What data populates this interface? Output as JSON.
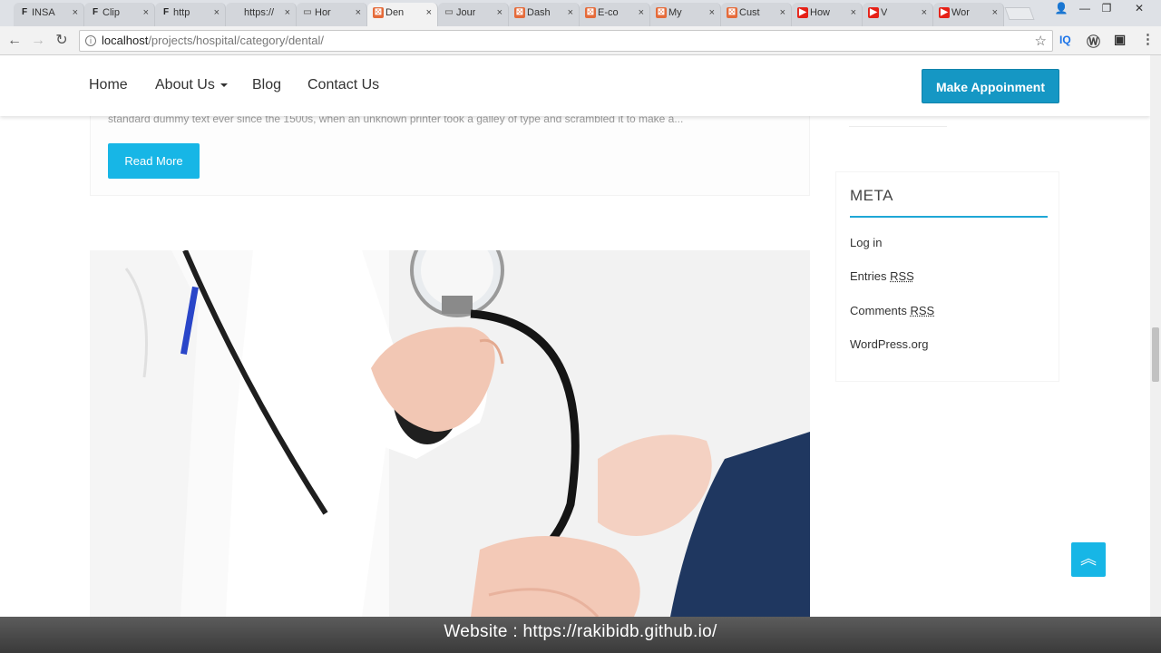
{
  "browser": {
    "tabs": [
      {
        "title": "INSA",
        "icon": "f-logo-icon",
        "color": "#222222",
        "active": false
      },
      {
        "title": "Clip",
        "icon": "f-logo-icon",
        "color": "#222222",
        "active": false
      },
      {
        "title": "http",
        "icon": "f-logo-icon",
        "color": "#222222",
        "active": false
      },
      {
        "title": "https://",
        "icon": "none",
        "color": "#222222",
        "active": false
      },
      {
        "title": "Hor",
        "icon": "page-icon",
        "color": "#777777",
        "active": false
      },
      {
        "title": "Den",
        "icon": "xampp-icon",
        "color": "#e56b3a",
        "active": true
      },
      {
        "title": "Jour",
        "icon": "page-icon",
        "color": "#777777",
        "active": false
      },
      {
        "title": "Dash",
        "icon": "xampp-icon",
        "color": "#e56b3a",
        "active": false
      },
      {
        "title": "E-co",
        "icon": "xampp-icon",
        "color": "#e56b3a",
        "active": false
      },
      {
        "title": "My",
        "icon": "xampp-icon",
        "color": "#e56b3a",
        "active": false
      },
      {
        "title": "Cust",
        "icon": "xampp-icon",
        "color": "#e56b3a",
        "active": false
      },
      {
        "title": "How",
        "icon": "youtube-icon",
        "color": "#e62117",
        "active": false
      },
      {
        "title": "V",
        "icon": "youtube-icon",
        "color": "#e62117",
        "active": false
      },
      {
        "title": "Wor",
        "icon": "youtube-icon",
        "color": "#e62117",
        "active": false
      }
    ],
    "close_glyph": "×",
    "url_host": "localhost",
    "url_path": "/projects/hospital/category/dental/",
    "ext_iq": "IQ"
  },
  "site": {
    "menu": [
      "Home",
      "About Us",
      "Blog",
      "Contact Us"
    ],
    "cta": "Make Appoinment",
    "excerpt": "standard dummy text ever since the 1500s, when an unknown printer took a galley of type and scrambled it to make a...",
    "read_more": "Read More",
    "sidebar": {
      "title": "META",
      "links": [
        {
          "text": "Log in",
          "abbr": ""
        },
        {
          "text": "Entries ",
          "abbr": "RSS"
        },
        {
          "text": "Comments ",
          "abbr": "RSS"
        },
        {
          "text": "WordPress.org",
          "abbr": ""
        }
      ]
    },
    "accent": "#17b6e6",
    "cta_color": "#1597c4"
  },
  "caption": "Website : https://rakibidb.github.io/"
}
